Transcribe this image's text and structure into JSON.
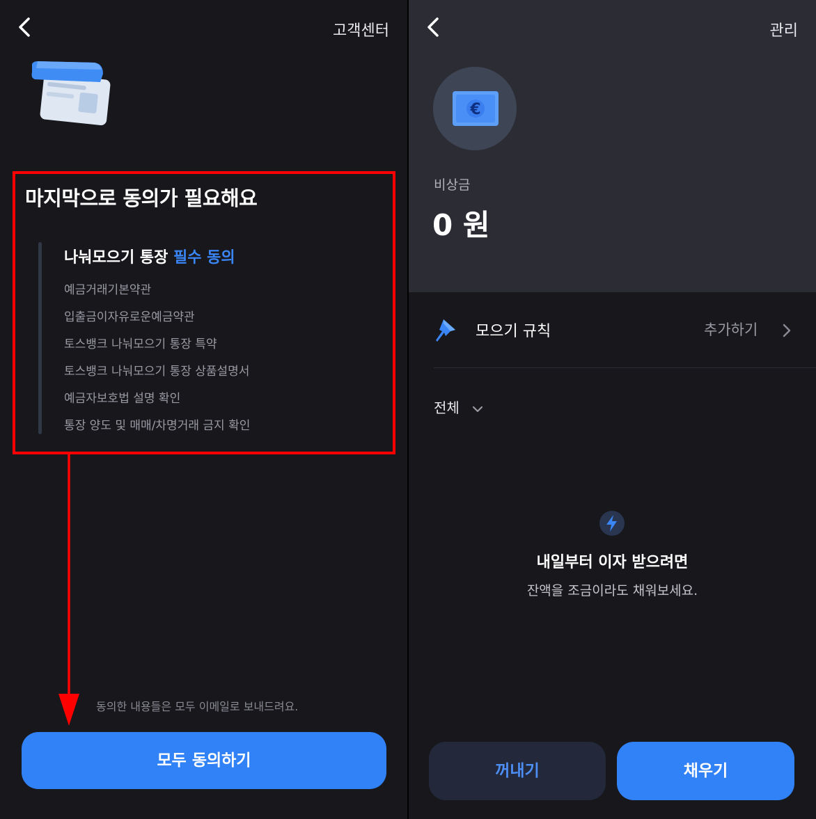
{
  "left": {
    "header": {
      "right_link": "고객센터"
    },
    "title": "마지막으로 동의가 필요해요",
    "section": {
      "title_prefix": "나눠모으기 통장",
      "title_required": "필수 동의",
      "terms": [
        "예금거래기본약관",
        "입출금이자유로운예금약관",
        "토스뱅크 나눠모으기 통장 특약",
        "토스뱅크 나눠모으기 통장 상품설명서",
        "예금자보호법 설명 확인",
        "통장 양도 및 매매/차명거래 금지 확인"
      ]
    },
    "footnote": "동의한 내용들은 모두 이메일로 보내드려요.",
    "agree_all_button": "모두 동의하기"
  },
  "right": {
    "header": {
      "right_link": "관리"
    },
    "account": {
      "name": "비상금",
      "balance": "0 원"
    },
    "rule_row": {
      "label": "모으기 규칙",
      "action": "추가하기"
    },
    "filter": {
      "label": "전체"
    },
    "empty_state": {
      "title": "내일부터 이자 받으려면",
      "subtitle": "잔액을 조금이라도 채워보세요."
    },
    "withdraw_button": "꺼내기",
    "fill_button": "채우기"
  },
  "colors": {
    "background": "#17171c",
    "top_card": "#2c2c35",
    "accent": "#3182f6",
    "secondary_button": "#23293b",
    "annotation": "#ff0000"
  }
}
